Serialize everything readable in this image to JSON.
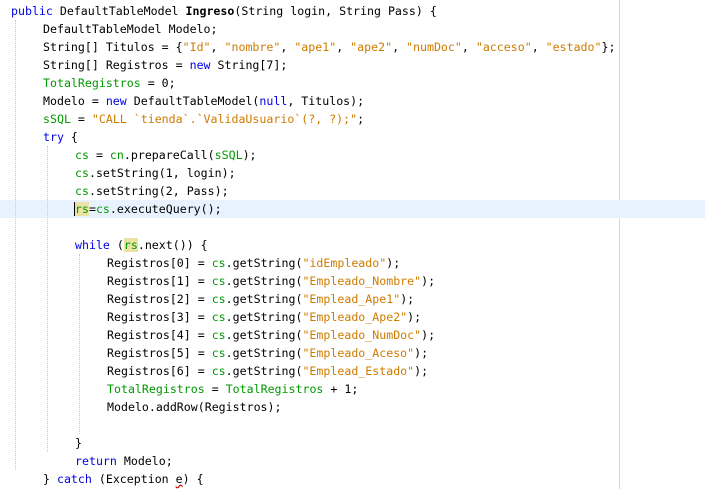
{
  "editor": {
    "lines": [
      {
        "indent": 0,
        "tokens": [
          {
            "t": "public",
            "s": "kw"
          },
          {
            "t": " DefaultTableModel ",
            "s": "plain"
          },
          {
            "t": "Ingreso",
            "s": "bold"
          },
          {
            "t": "(String login, String Pass) {",
            "s": "plain"
          }
        ]
      },
      {
        "indent": 1,
        "tokens": [
          {
            "t": "DefaultTableModel Modelo;",
            "s": "plain"
          }
        ]
      },
      {
        "indent": 1,
        "tokens": [
          {
            "t": "String[] Titulos = {",
            "s": "plain"
          },
          {
            "t": "\"Id\"",
            "s": "str"
          },
          {
            "t": ", ",
            "s": "plain"
          },
          {
            "t": "\"nombre\"",
            "s": "str"
          },
          {
            "t": ", ",
            "s": "plain"
          },
          {
            "t": "\"ape1\"",
            "s": "str"
          },
          {
            "t": ", ",
            "s": "plain"
          },
          {
            "t": "\"ape2\"",
            "s": "str"
          },
          {
            "t": ", ",
            "s": "plain"
          },
          {
            "t": "\"numDoc\"",
            "s": "str"
          },
          {
            "t": ", ",
            "s": "plain"
          },
          {
            "t": "\"acceso\"",
            "s": "str"
          },
          {
            "t": ", ",
            "s": "plain"
          },
          {
            "t": "\"estado\"",
            "s": "str"
          },
          {
            "t": "};",
            "s": "plain"
          }
        ]
      },
      {
        "indent": 1,
        "tokens": [
          {
            "t": "String[] Registros = ",
            "s": "plain"
          },
          {
            "t": "new",
            "s": "kw"
          },
          {
            "t": " String[7];",
            "s": "plain"
          }
        ]
      },
      {
        "indent": 1,
        "tokens": [
          {
            "t": "TotalRegistros",
            "s": "fld"
          },
          {
            "t": " = 0;",
            "s": "plain"
          }
        ]
      },
      {
        "indent": 1,
        "tokens": [
          {
            "t": "Modelo = ",
            "s": "plain"
          },
          {
            "t": "new",
            "s": "kw"
          },
          {
            "t": " DefaultTableModel(",
            "s": "plain"
          },
          {
            "t": "null",
            "s": "kw"
          },
          {
            "t": ", Titulos);",
            "s": "plain"
          }
        ]
      },
      {
        "indent": 1,
        "tokens": [
          {
            "t": "sSQL",
            "s": "fld"
          },
          {
            "t": " = ",
            "s": "plain"
          },
          {
            "t": "\"CALL `tienda`.`ValidaUsuario`(?, ?);\"",
            "s": "str"
          },
          {
            "t": ";",
            "s": "plain"
          }
        ]
      },
      {
        "indent": 1,
        "tokens": [
          {
            "t": "try",
            "s": "kw"
          },
          {
            "t": " {",
            "s": "plain"
          }
        ]
      },
      {
        "indent": 2,
        "tokens": [
          {
            "t": "cs",
            "s": "fld"
          },
          {
            "t": " = ",
            "s": "plain"
          },
          {
            "t": "cn",
            "s": "fld"
          },
          {
            "t": ".prepareCall(",
            "s": "plain"
          },
          {
            "t": "sSQL",
            "s": "fld"
          },
          {
            "t": ");",
            "s": "plain"
          }
        ]
      },
      {
        "indent": 2,
        "tokens": [
          {
            "t": "cs",
            "s": "fld"
          },
          {
            "t": ".setString(1, login);",
            "s": "plain"
          }
        ]
      },
      {
        "indent": 2,
        "tokens": [
          {
            "t": "cs",
            "s": "fld"
          },
          {
            "t": ".setString(2, Pass);",
            "s": "plain"
          }
        ]
      },
      {
        "indent": 2,
        "current": true,
        "tokens": [
          {
            "t": "rs",
            "s": "fld-hl-caret"
          },
          {
            "t": "=",
            "s": "plain"
          },
          {
            "t": "cs",
            "s": "fld"
          },
          {
            "t": ".executeQuery();",
            "s": "plain"
          }
        ]
      },
      {
        "indent": 0,
        "tokens": []
      },
      {
        "indent": 2,
        "tokens": [
          {
            "t": "while",
            "s": "kw"
          },
          {
            "t": " (",
            "s": "plain"
          },
          {
            "t": "rs",
            "s": "fld-hl"
          },
          {
            "t": ".next()) {",
            "s": "plain"
          }
        ]
      },
      {
        "indent": 3,
        "tokens": [
          {
            "t": "Registros[0] = ",
            "s": "plain"
          },
          {
            "t": "cs",
            "s": "fld"
          },
          {
            "t": ".getString(",
            "s": "plain"
          },
          {
            "t": "\"idEmpleado\"",
            "s": "str"
          },
          {
            "t": ");",
            "s": "plain"
          }
        ]
      },
      {
        "indent": 3,
        "tokens": [
          {
            "t": "Registros[1] = ",
            "s": "plain"
          },
          {
            "t": "cs",
            "s": "fld"
          },
          {
            "t": ".getString(",
            "s": "plain"
          },
          {
            "t": "\"Empleado_Nombre\"",
            "s": "str"
          },
          {
            "t": ");",
            "s": "plain"
          }
        ]
      },
      {
        "indent": 3,
        "tokens": [
          {
            "t": "Registros[2] = ",
            "s": "plain"
          },
          {
            "t": "cs",
            "s": "fld"
          },
          {
            "t": ".getString(",
            "s": "plain"
          },
          {
            "t": "\"Emplead_Ape1\"",
            "s": "str"
          },
          {
            "t": ");",
            "s": "plain"
          }
        ]
      },
      {
        "indent": 3,
        "tokens": [
          {
            "t": "Registros[3] = ",
            "s": "plain"
          },
          {
            "t": "cs",
            "s": "fld"
          },
          {
            "t": ".getString(",
            "s": "plain"
          },
          {
            "t": "\"Empleado_Ape2\"",
            "s": "str"
          },
          {
            "t": ");",
            "s": "plain"
          }
        ]
      },
      {
        "indent": 3,
        "tokens": [
          {
            "t": "Registros[4] = ",
            "s": "plain"
          },
          {
            "t": "cs",
            "s": "fld"
          },
          {
            "t": ".getString(",
            "s": "plain"
          },
          {
            "t": "\"Empleado_NumDoc\"",
            "s": "str"
          },
          {
            "t": ");",
            "s": "plain"
          }
        ]
      },
      {
        "indent": 3,
        "tokens": [
          {
            "t": "Registros[5] = ",
            "s": "plain"
          },
          {
            "t": "cs",
            "s": "fld"
          },
          {
            "t": ".getString(",
            "s": "plain"
          },
          {
            "t": "\"Empleado_Aceso\"",
            "s": "str"
          },
          {
            "t": ");",
            "s": "plain"
          }
        ]
      },
      {
        "indent": 3,
        "tokens": [
          {
            "t": "Registros[6] = ",
            "s": "plain"
          },
          {
            "t": "cs",
            "s": "fld"
          },
          {
            "t": ".getString(",
            "s": "plain"
          },
          {
            "t": "\"Emplead_Estado\"",
            "s": "str"
          },
          {
            "t": ");",
            "s": "plain"
          }
        ]
      },
      {
        "indent": 3,
        "tokens": [
          {
            "t": "TotalRegistros",
            "s": "fld"
          },
          {
            "t": " = ",
            "s": "plain"
          },
          {
            "t": "TotalRegistros",
            "s": "fld"
          },
          {
            "t": " + 1;",
            "s": "plain"
          }
        ]
      },
      {
        "indent": 3,
        "tokens": [
          {
            "t": "Modelo.addRow(Registros);",
            "s": "plain"
          }
        ]
      },
      {
        "indent": 0,
        "tokens": []
      },
      {
        "indent": 2,
        "tokens": [
          {
            "t": "}",
            "s": "plain"
          }
        ]
      },
      {
        "indent": 2,
        "tokens": [
          {
            "t": "return",
            "s": "kw"
          },
          {
            "t": " Modelo;",
            "s": "plain"
          }
        ]
      },
      {
        "indent": 1,
        "tokens": [
          {
            "t": "} ",
            "s": "plain"
          },
          {
            "t": "catch",
            "s": "kw"
          },
          {
            "t": " (Exception ",
            "s": "plain"
          },
          {
            "t": "e",
            "s": "err"
          },
          {
            "t": ") {",
            "s": "plain"
          }
        ]
      }
    ]
  },
  "colors": {
    "keyword": "#0000e6",
    "string": "#ce7b00",
    "field": "#009900",
    "current_line": "#e8f2fe",
    "occurrence_highlight": "#ebe3a6",
    "margin_line": "#f3c9c9"
  }
}
